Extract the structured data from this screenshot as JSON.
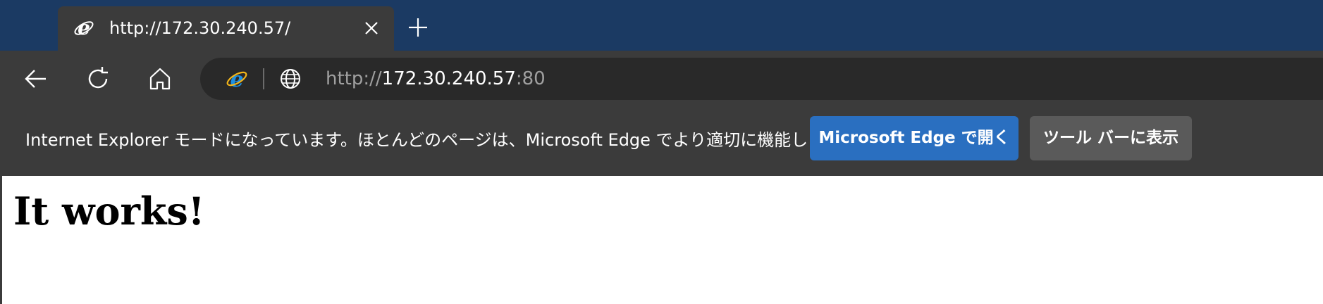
{
  "tab": {
    "title": "http://172.30.240.57/"
  },
  "address": {
    "scheme": "http://",
    "host": "172.30.240.57",
    "port": ":80"
  },
  "infobar": {
    "message": "Internet Explorer モードになっています。ほとんどのページは、Microsoft Edge でより適切に機能します。",
    "open_in_edge": "Microsoft Edge で開く",
    "show_in_toolbar": "ツール バーに表示"
  },
  "page": {
    "heading": "It works!"
  },
  "colors": {
    "tabstrip": "#1b3a63",
    "chrome": "#3b3b3b",
    "address_bar": "#292929",
    "primary_button": "#2a6fc0",
    "secondary_button": "#5a5a5a"
  },
  "icons": [
    "ie-icon",
    "close-icon",
    "plus-icon",
    "back-arrow-icon",
    "refresh-icon",
    "home-icon",
    "globe-icon"
  ]
}
